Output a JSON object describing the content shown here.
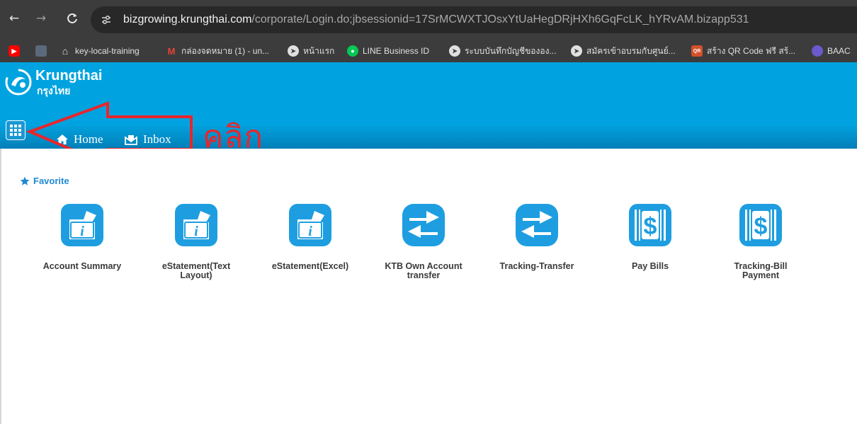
{
  "browser": {
    "url_host": "bizgrowing.krungthai.com",
    "url_path": "/corporate/Login.do;jbsessionid=17SrMCWXTJOsxYtUaHegDRjHXh6GqFcLK_hYRvAM.bizapp531",
    "bookmarks": [
      {
        "label": "key-local-training",
        "icon": "home-icon"
      },
      {
        "label": "กล่องจดหมาย (1) - un...",
        "icon": "gmail-icon"
      },
      {
        "label": "หน้าแรก",
        "icon": "globe-icon"
      },
      {
        "label": "LINE Business ID",
        "icon": "line-icon"
      },
      {
        "label": "ระบบบันทึกบัญชีขององ...",
        "icon": "globe-icon"
      },
      {
        "label": "สมัครเข้าอบรมกับศูนย์...",
        "icon": "globe-icon"
      },
      {
        "label": "สร้าง QR Code ฟรี สร้...",
        "icon": "qr-icon"
      },
      {
        "label": "BAAC",
        "icon": "baac-icon"
      }
    ]
  },
  "header": {
    "brand": "Krungthai",
    "brand_sub": "กรุงไทย",
    "nav": {
      "home": "Home",
      "inbox": "Inbox"
    },
    "annotation": "คลิก",
    "colors": {
      "primary": "#00a3e0",
      "annotation": "#e8262a"
    }
  },
  "favorite": {
    "title": "Favorite",
    "items": [
      {
        "label": "Account Summary",
        "icon": "info-folder-icon"
      },
      {
        "label": "eStatement(Text Layout)",
        "icon": "info-folder-icon"
      },
      {
        "label": "eStatement(Excel)",
        "icon": "info-folder-icon"
      },
      {
        "label": "KTB Own Account transfer",
        "icon": "transfer-arrows-icon"
      },
      {
        "label": "Tracking-Transfer",
        "icon": "transfer-arrows-icon"
      },
      {
        "label": "Pay Bills",
        "icon": "dollar-bill-icon"
      },
      {
        "label": "Tracking-Bill Payment",
        "icon": "dollar-bill-icon"
      }
    ]
  }
}
